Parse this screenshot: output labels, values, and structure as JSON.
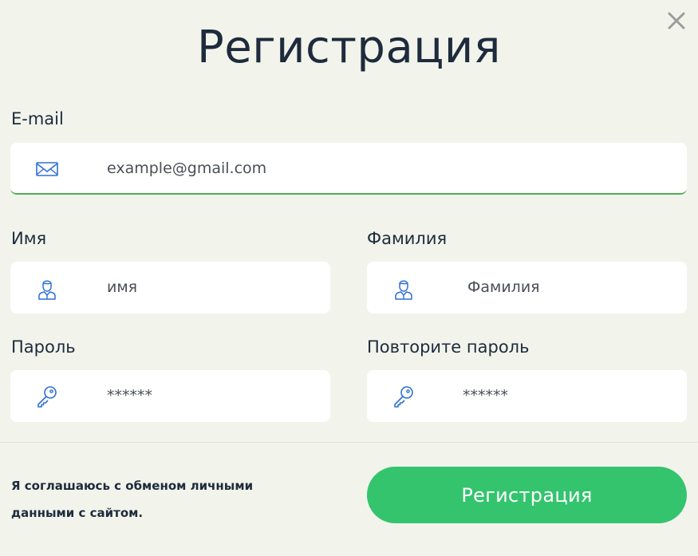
{
  "title": "Регистрация",
  "email": {
    "label": "E-mail",
    "placeholder": "example@gmail.com",
    "icon": "envelope-icon"
  },
  "first_name": {
    "label": "Имя",
    "placeholder": "имя",
    "icon": "user-icon"
  },
  "last_name": {
    "label": "Фамилия",
    "placeholder": "Фамилия",
    "icon": "user-icon"
  },
  "password": {
    "label": "Пароль",
    "placeholder": "******",
    "icon": "key-icon"
  },
  "password_repeat": {
    "label": "Повторите пароль",
    "placeholder": "******",
    "icon": "key-icon"
  },
  "consent_text": "Я соглашаюсь с обменом личными данными с сайтом.",
  "submit_label": "Регистрация",
  "colors": {
    "background": "#f2f4ec",
    "accent": "#34c46e",
    "icon": "#2f6fd6",
    "text": "#1e2b3c"
  }
}
